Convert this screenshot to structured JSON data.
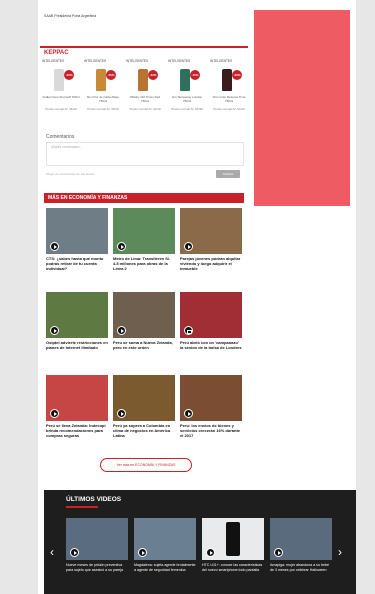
{
  "top_line": "SAAB Presidenta Porta Argentina",
  "ad": {
    "brand": "KEPPAC",
    "products": [
      {
        "title": "INTELGENTES",
        "desc": "Vodka Oxen Smirnoff 700ml",
        "price": "Precio normal S/. 45.00",
        "discount": "-20%",
        "bottle_color": "#d9d9d9"
      },
      {
        "title": "INTELGENTES",
        "desc": "Ron Flor de Caña Añejo 750ml",
        "price": "Precio normal S/. 38.90",
        "discount": "-25%",
        "bottle_color": "#c98a35"
      },
      {
        "title": "INTELGENTES",
        "desc": "Whisky Old Times Red 750ml",
        "price": "Precio normal S/. 42.00",
        "discount": "-30%",
        "bottle_color": "#b87333"
      },
      {
        "title": "INTELGENTES",
        "desc": "Gin Tanqueray London 750ml",
        "price": "Precio normal S/. 89.90",
        "discount": "-15%",
        "bottle_color": "#2f6f5e"
      },
      {
        "title": "INTELGENTES",
        "desc": "Vino Gran Reserva Tinto 750ml",
        "price": "Precio normal S/. 54.00",
        "discount": "-20%",
        "bottle_color": "#3a1c1c"
      }
    ]
  },
  "comments": {
    "label": "Comentarios",
    "placeholder": "Añadir comentario...",
    "footer": "Plugin de comentarios de Facebook",
    "button": "Publicar"
  },
  "section_title": "MÁS EN ECONOMÍA Y FINANZAS",
  "articles": [
    {
      "caption": "CTS: ¿sabes hasta qué monto podrás retirar de tu cuenta individual?",
      "icon": "play-icon",
      "thumb": "#6e7d86"
    },
    {
      "caption": "Metro de Lima: Transfieren S/. 4.5 millones para obras de la Línea 2",
      "icon": "play-icon",
      "thumb": "#5c8a5a"
    },
    {
      "caption": "Parejas jóvenes podrán alquilar viviendo y luego adquirir el inmueble",
      "icon": "play-icon",
      "thumb": "#8b6a4a"
    },
    {
      "caption": "Osiptel advierte restricciones en planes de Internet ilimitado",
      "icon": "play-icon",
      "thumb": "#5e7a42"
    },
    {
      "caption": "Perú se suma a Nueva Zelanda, pero en este orden",
      "icon": "play-icon",
      "thumb": "#6f5f4f"
    },
    {
      "caption": "Perú abrió con un 'campanazo' la sesión de la bolsa de Londres",
      "icon": "camera-icon",
      "thumb": "#a22e35"
    },
    {
      "caption": "Perú se lleva Zelanda: Indecopi brinda recomendaciones para compras seguras",
      "icon": "play-icon",
      "thumb": "#c64545"
    },
    {
      "caption": "Perú ya supera a Colombia en clima de negocios en América Latina",
      "icon": "play-icon",
      "thumb": "#7a5a2e"
    },
    {
      "caption": "Perú: los envíos de bienes y servicios crecerán 16% durante el 2017",
      "icon": "play-icon",
      "thumb": "#7b4d33"
    }
  ],
  "more_button": "Ver más en ECONOMÍA Y FINANZAS",
  "videos": {
    "title": "ÚLTIMOS VIDEOS",
    "items": [
      {
        "caption": "Nueve meses de prisión preventiva para sujeto que asesinó a su pareja",
        "thumb": "#5a6c80"
      },
      {
        "caption": "Magdalena: sujeta agrede brutalmente a agente de seguridad femenina",
        "thumb": "#6a7f92"
      },
      {
        "caption": "HTC U11+: conoce las características del nuevo smartphone todo pantalla",
        "thumb": "#e9eaeb"
      },
      {
        "caption": "Amapiga: mujer abandona a su bebé de 3 meses por celebrar Halloween",
        "thumb": "#596b7c"
      }
    ],
    "prev": "‹",
    "next": "›"
  }
}
